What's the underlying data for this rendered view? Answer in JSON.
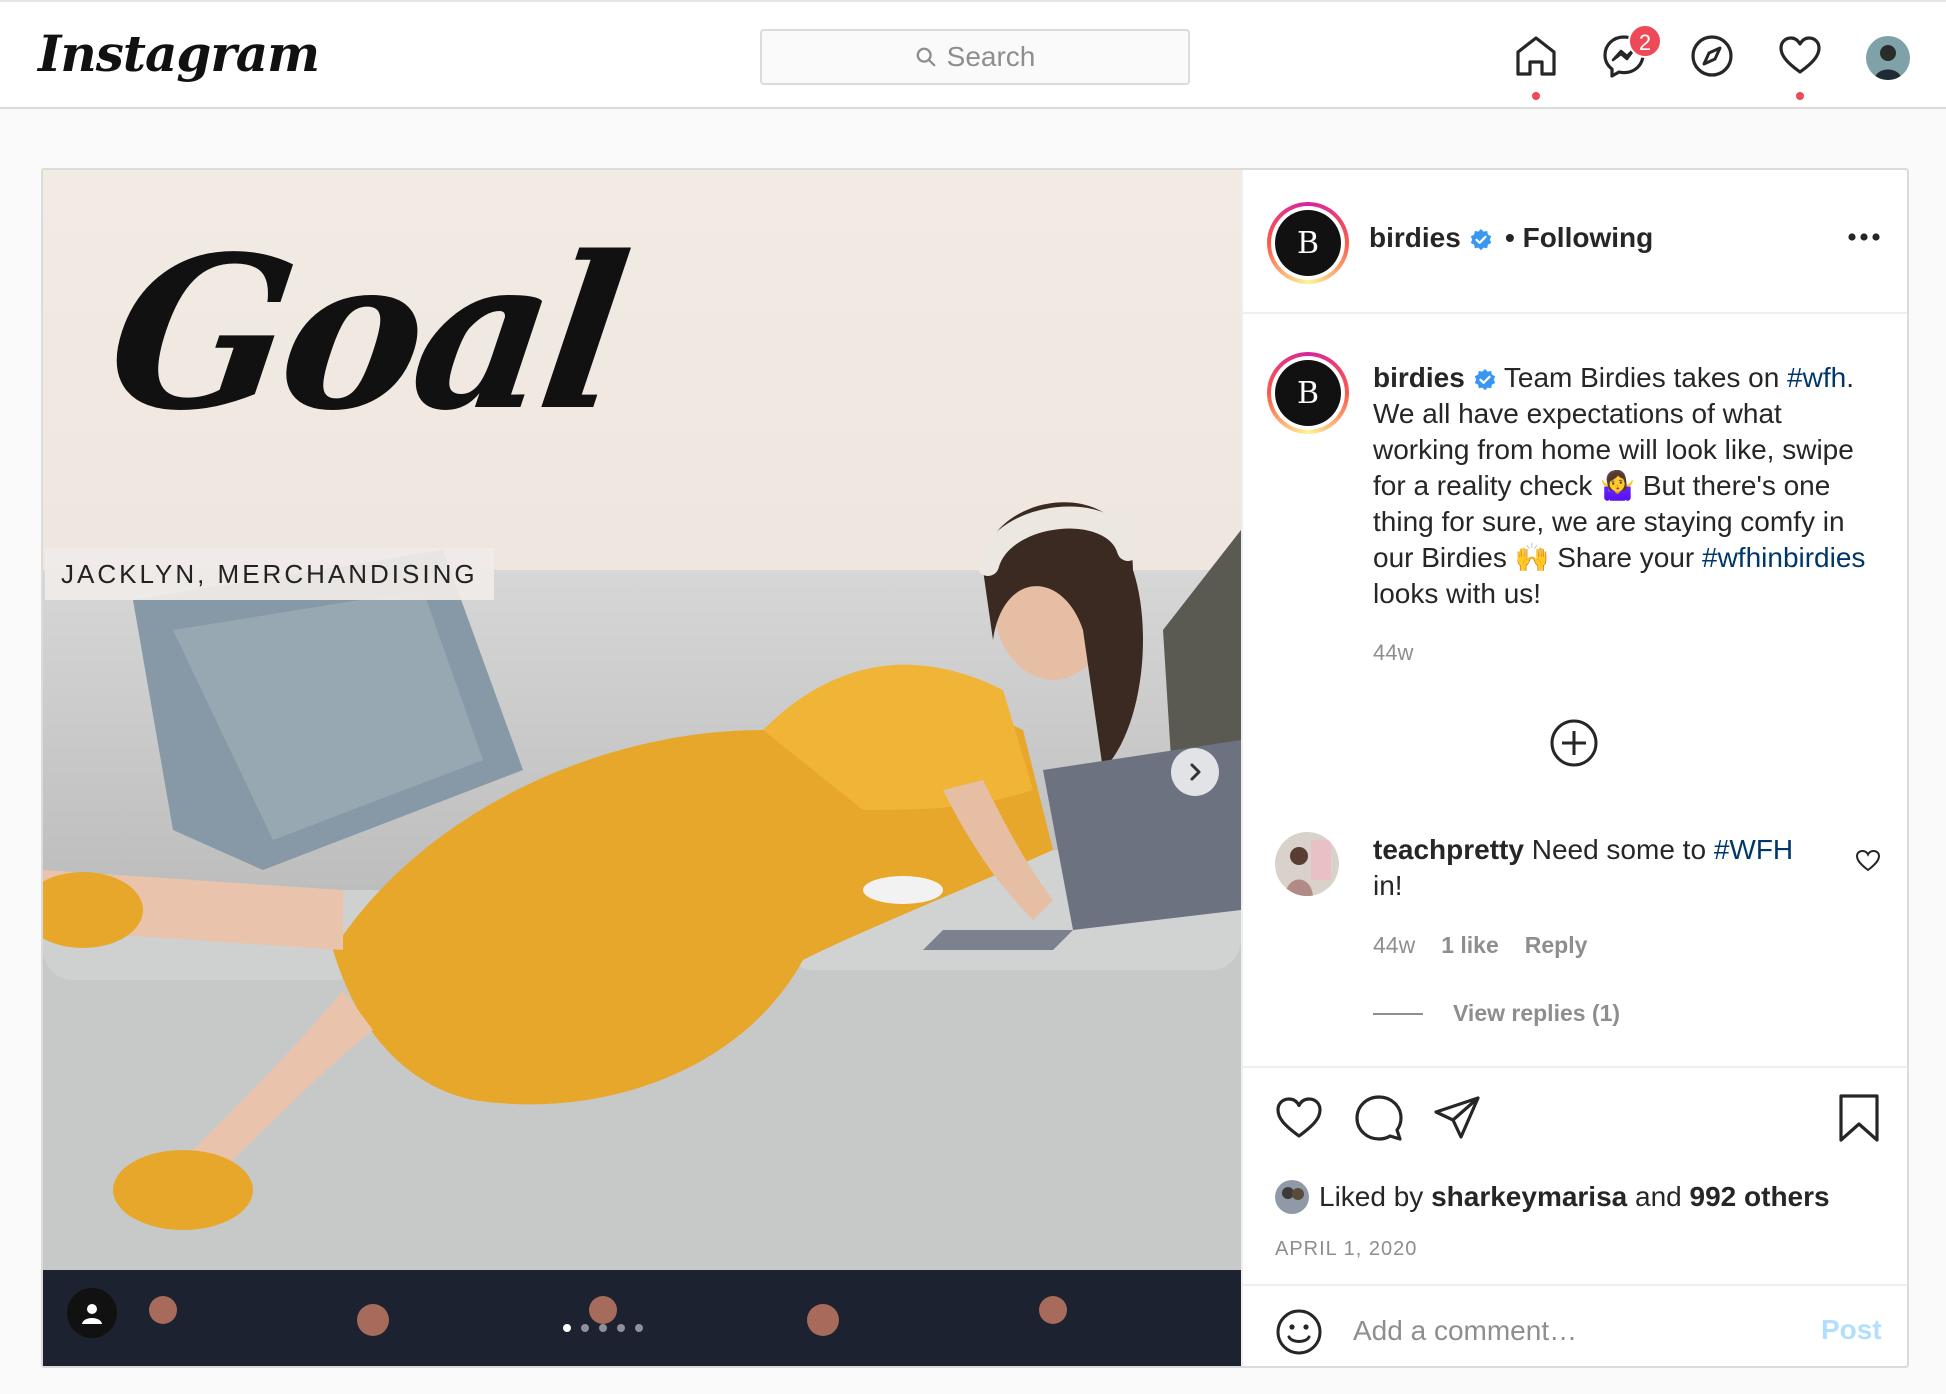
{
  "app": {
    "logo_text": "Instagram"
  },
  "nav": {
    "search_placeholder": "Search",
    "messenger_badge": "2",
    "icons": [
      "home-icon",
      "messenger-icon",
      "explore-icon",
      "activity-heart-icon",
      "profile-avatar"
    ]
  },
  "photo": {
    "headline": "Goal",
    "label": "JACKLYN, MERCHANDISING"
  },
  "post": {
    "username": "birdies",
    "separator": "•",
    "follow_status": "Following",
    "avatar_initial": "B",
    "caption": {
      "username": "birdies",
      "text_1": " Team Birdies takes on ",
      "tag_1": "#wfh",
      "text_2": ". We all have expectations of what working from home will look like, swipe for a reality check 🤷‍♀️ But there's one thing for sure, we are staying comfy in our Birdies 🙌 Share your ",
      "tag_2": "#wfhinbirdies",
      "text_3": " looks with us!",
      "time": "44w"
    },
    "comment": {
      "username": "teachpretty",
      "text_1": " Need some to ",
      "tag": "#WFH",
      "text_2": " in!",
      "time": "44w",
      "likes": "1 like",
      "reply_label": "Reply",
      "view_replies": "View replies (1)"
    },
    "liked_by": {
      "prefix": "Liked by ",
      "user": "sharkeymarisa",
      "middle": " and ",
      "others": "992 others"
    },
    "date": "APRIL 1, 2020",
    "comment_placeholder": "Add a comment…",
    "post_button": "Post"
  },
  "colors": {
    "link_blue": "#00376b",
    "verified_blue": "#3897f0",
    "notification_red": "#ed4956",
    "muted_gray": "#8e8e8e",
    "post_button_disabled": "#b2dffc"
  }
}
